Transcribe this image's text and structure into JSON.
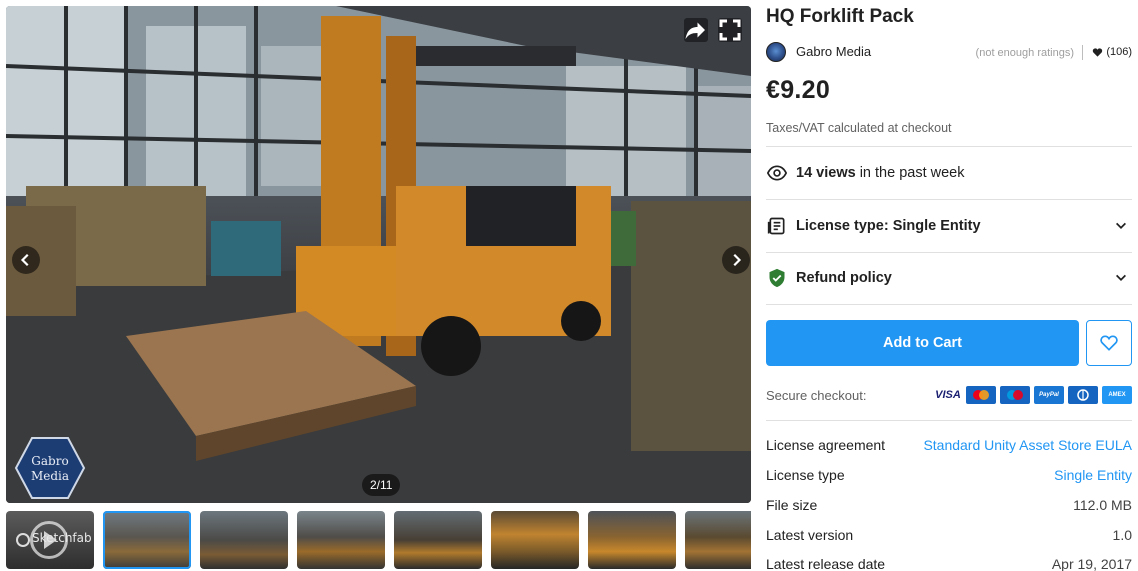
{
  "product": {
    "title": "HQ Forklift Pack",
    "seller": "Gabro Media",
    "ratings_text": "(not enough ratings)",
    "favorites": "(106)",
    "price": "€9.20",
    "tax_note": "Taxes/VAT calculated at checkout"
  },
  "views": {
    "count": "14 views",
    "suffix": " in the past week"
  },
  "license": {
    "label": "License type: Single Entity"
  },
  "refund": {
    "label": "Refund policy"
  },
  "cart": {
    "add_label": "Add to Cart",
    "secure_label": "Secure checkout:"
  },
  "payment_cards": [
    "VISA",
    "mastercard",
    "maestro",
    "PayPal",
    "Diners",
    "AMEX"
  ],
  "viewer": {
    "counter": "2/11",
    "logo_text": "Gabro Media",
    "sketchfab_label": "Sketchfab",
    "thumbnail_count": 8,
    "active_thumbnail": 2
  },
  "specs": [
    {
      "key": "License agreement",
      "value": "Standard Unity Asset Store EULA",
      "link": true
    },
    {
      "key": "License type",
      "value": "Single Entity",
      "link": true
    },
    {
      "key": "File size",
      "value": "112.0 MB",
      "link": false
    },
    {
      "key": "Latest version",
      "value": "1.0",
      "link": false
    },
    {
      "key": "Latest release date",
      "value": "Apr 19, 2017",
      "link": false
    }
  ],
  "colors": {
    "accent": "#2196f3",
    "text": "#212121",
    "muted": "#9e9e9e",
    "refund_shield": "#2e7d32"
  }
}
